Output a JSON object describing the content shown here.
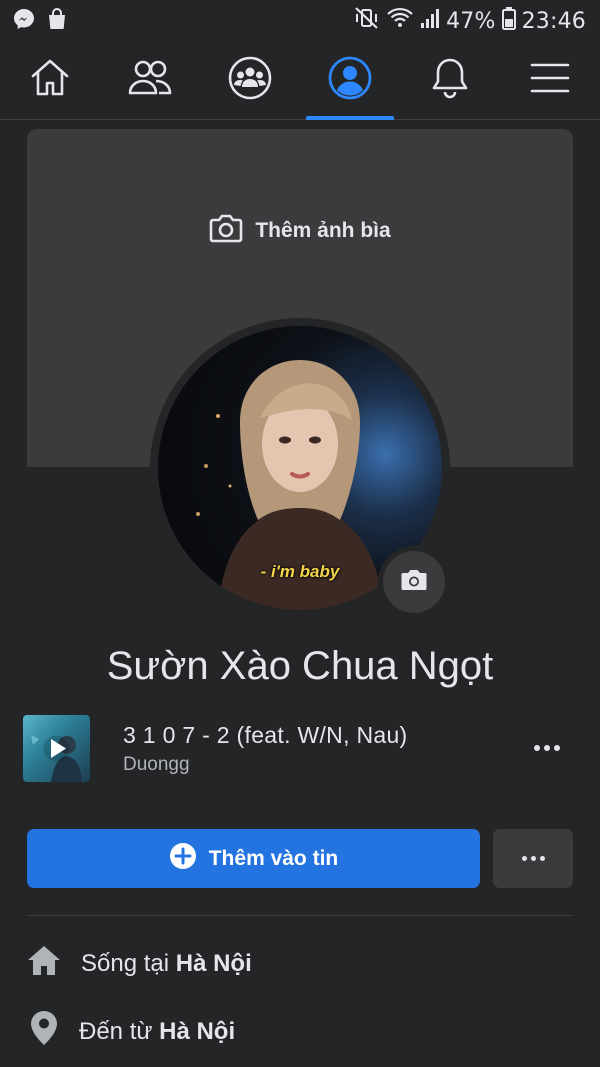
{
  "status_bar": {
    "battery": "47%",
    "time": "23:46",
    "left_icons": [
      "messenger-icon",
      "shopping-bag-icon"
    ],
    "right_icons": [
      "mute-vibrate-icon",
      "wifi-icon",
      "signal-icon",
      "battery-icon"
    ]
  },
  "nav": {
    "items": [
      {
        "name": "home",
        "icon": "home-icon",
        "active": false
      },
      {
        "name": "friends",
        "icon": "friends-icon",
        "active": false
      },
      {
        "name": "groups",
        "icon": "groups-icon",
        "active": false
      },
      {
        "name": "profile",
        "icon": "profile-icon",
        "active": true
      },
      {
        "name": "notifications",
        "icon": "bell-icon",
        "active": false
      },
      {
        "name": "menu",
        "icon": "menu-icon",
        "active": false
      }
    ],
    "active_color": "#2d88ff"
  },
  "profile": {
    "cover_add_label": "Thêm ảnh bìa",
    "avatar_caption": "- i'm baby",
    "name": "Sườn Xào Chua Ngọt"
  },
  "music": {
    "title": "3 1 0 7 - 2 (feat. W/N, Nau)",
    "artist": "Duongg"
  },
  "actions": {
    "add_story_label": "Thêm vào tin",
    "primary_color": "#2374e1"
  },
  "details": {
    "lives_prefix": "Sống tại ",
    "lives_place": "Hà Nội",
    "from_prefix": "Đến từ ",
    "from_place": "Hà Nội"
  }
}
